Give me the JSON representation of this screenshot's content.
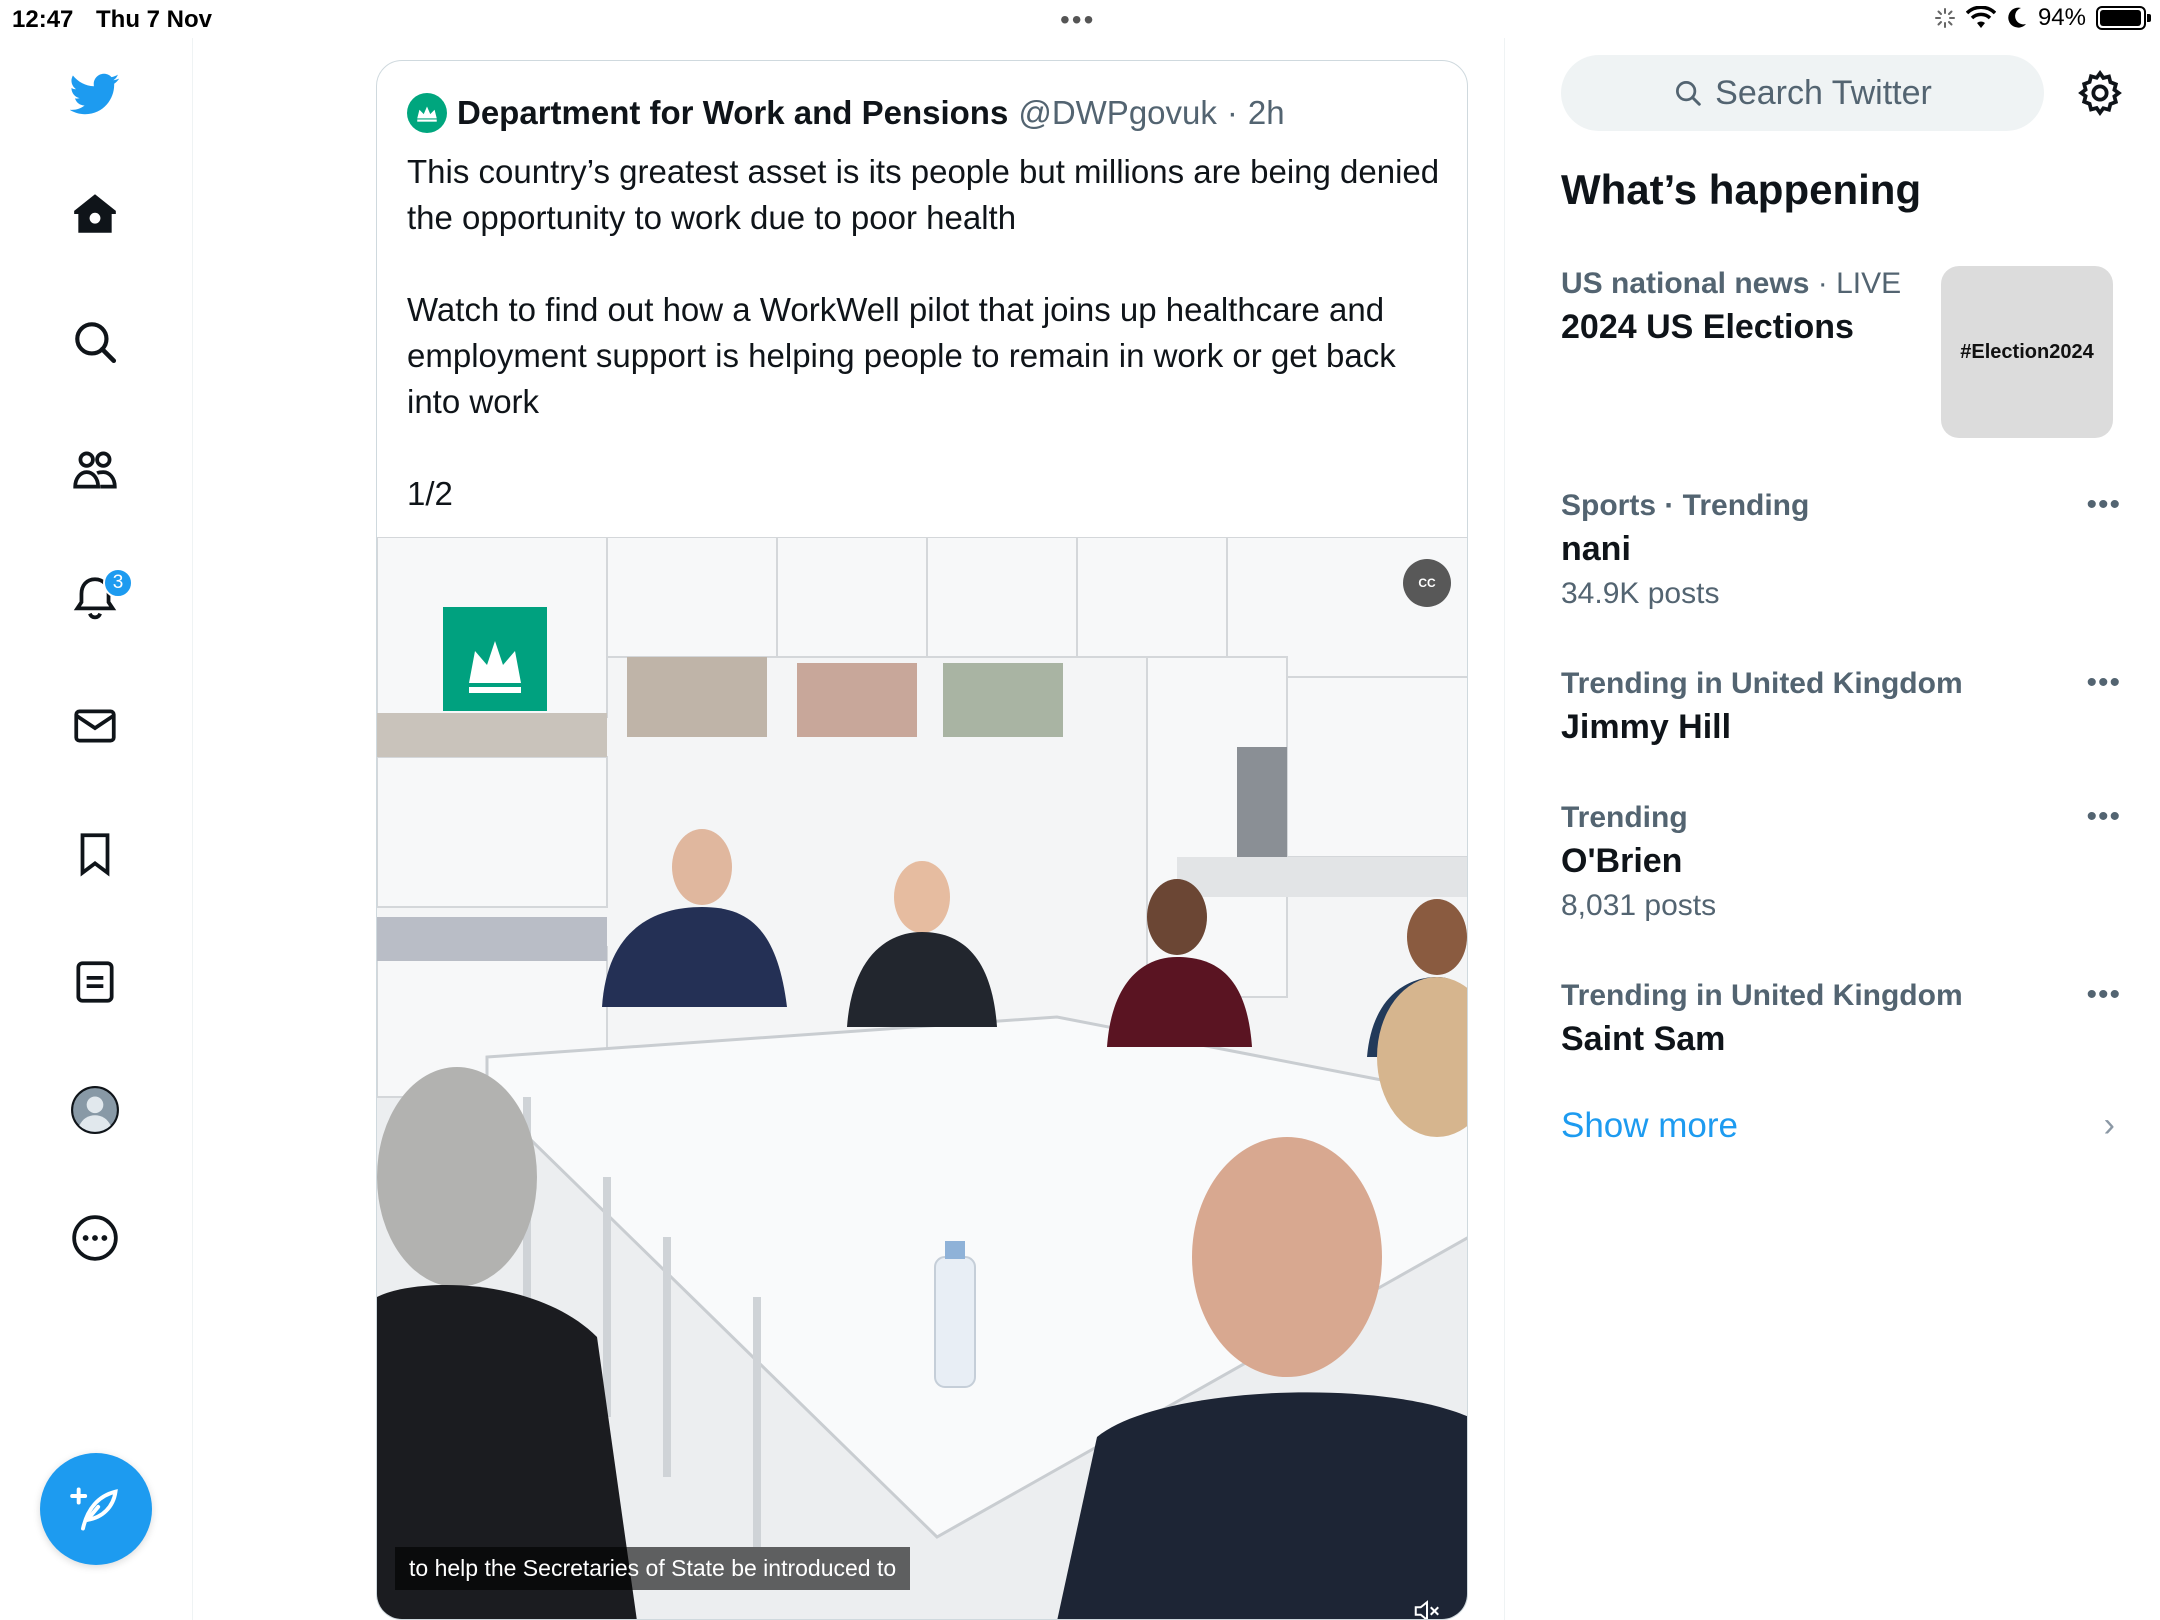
{
  "status_bar": {
    "time": "12:47",
    "date": "Thu 7 Nov",
    "battery": "94%",
    "battery_level": 0.94
  },
  "sidebar": {
    "logo": "twitter-bird-icon",
    "items": [
      {
        "icon": "home-icon"
      },
      {
        "icon": "search-icon"
      },
      {
        "icon": "communities-icon"
      },
      {
        "icon": "bell-icon",
        "badge": "3"
      },
      {
        "icon": "mail-icon"
      },
      {
        "icon": "bookmark-icon"
      },
      {
        "icon": "lists-icon"
      },
      {
        "icon": "profile-avatar-icon"
      },
      {
        "icon": "more-icon"
      }
    ],
    "compose_icon": "compose-icon",
    "accent_color": "#1d9bf0"
  },
  "tweet": {
    "author_name": "Department for Work and Pensions",
    "handle": "@DWPgovuk",
    "separator": "·",
    "time": "2h",
    "paragraph1": "This country’s greatest asset is its people but millions are being denied the opportunity to work due to poor health",
    "paragraph2": "Watch to find out how a WorkWell pilot that joins up healthcare and employment support is helping people to remain in work or get back into work",
    "thread_count": "1/2",
    "video": {
      "caption": "to help the Secretaries of State be introduced to",
      "cc_label": "CC"
    }
  },
  "right": {
    "search_placeholder": "Search Twitter",
    "section_title": "What’s happening",
    "trends": [
      {
        "category": "US national news",
        "sep": " · ",
        "status": "LIVE",
        "name": "2024 US Elections",
        "image_text": "#Election2024"
      },
      {
        "category": "Sports · Trending",
        "name": "nani",
        "posts": "34.9K posts"
      },
      {
        "category": "Trending in United Kingdom",
        "name": "Jimmy Hill"
      },
      {
        "category": "Trending",
        "name": "O'Brien",
        "posts": "8,031 posts"
      },
      {
        "category": "Trending in United Kingdom",
        "name": "Saint Sam"
      }
    ],
    "show_more": "Show more",
    "more_dots": "•••"
  }
}
